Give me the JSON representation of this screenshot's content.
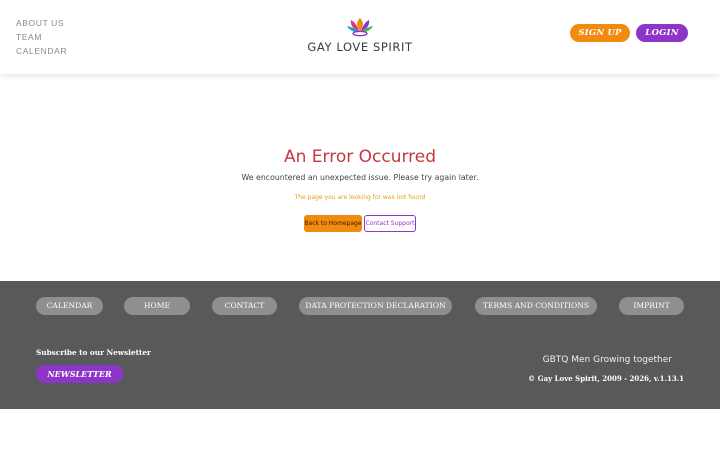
{
  "header": {
    "nav": [
      "ABOUT US",
      "TEAM",
      "CALENDAR"
    ],
    "logo_text": "GAY LOVE SPIRIT",
    "signup_label": "SIGN UP",
    "login_label": "LOGIN"
  },
  "error": {
    "title": "An Error Occurred",
    "message": "We encountered an unexpected issue. Please try again later.",
    "detail": "The page you are looking for was not found",
    "home_button": "Back to Homepage",
    "support_button": "Contact Support"
  },
  "footer": {
    "links": [
      "CALENDAR",
      "HOME",
      "CONTACT",
      "DATA PROTECTION DECLARATION",
      "TERMS AND CONDITIONS",
      "IMPRINT"
    ],
    "subscribe_label": "Subscribe to our Newsletter",
    "newsletter_button": "NEWSLETTER",
    "tagline": "GBTQ Men Growing together",
    "copyright": "© Gay Love Spirit, 2009 - 2026, v.1.13.1"
  },
  "colors": {
    "accent_orange": "#f28a10",
    "accent_purple": "#8d35c9",
    "error_red": "#c9363e",
    "footer_bg": "#58595b"
  }
}
